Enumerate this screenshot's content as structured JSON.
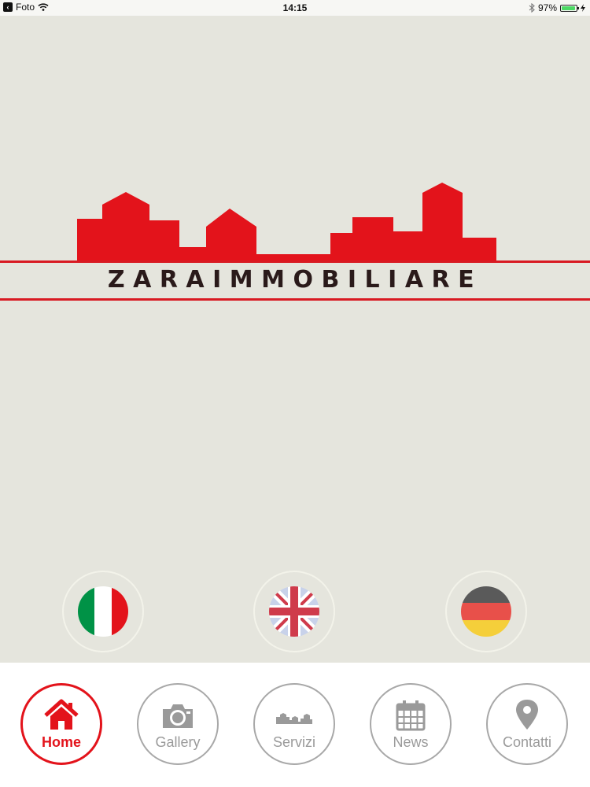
{
  "status_bar": {
    "back_app": "Foto",
    "time": "14:15",
    "battery": "97%",
    "battery_level": 0.97
  },
  "brand": {
    "name": "ZARAIMMOBILIARE",
    "accent_color": "#e3131b"
  },
  "languages": [
    {
      "icon": "italy-flag-icon"
    },
    {
      "icon": "uk-flag-icon"
    },
    {
      "icon": "germany-flag-icon"
    }
  ],
  "nav": {
    "home": "Home",
    "gallery": "Gallery",
    "servizi": "Servizi",
    "news": "News",
    "contatti": "Contatti"
  }
}
